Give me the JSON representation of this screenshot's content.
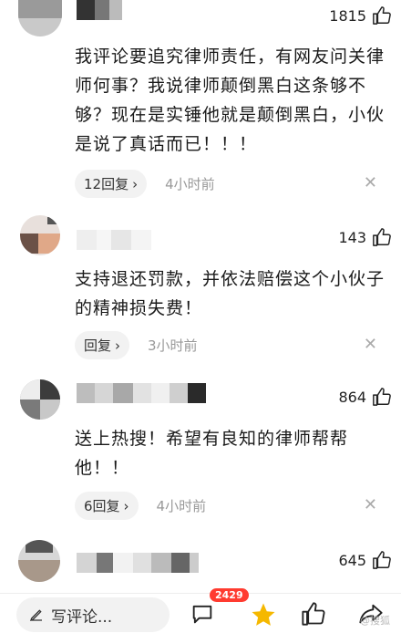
{
  "comments": [
    {
      "likes": "1815",
      "text": "我评论要追究律师责任，有网友问关律师何事？我说律师颠倒黑白这条够不够？现在是实锤他就是颠倒黑白，小伙是说了真话而已！！！",
      "reply_label": "12回复",
      "time": "4小时前"
    },
    {
      "likes": "143",
      "text": "支持退还罚款，并依法赔偿这个小伙子的精神损失费！",
      "reply_label": "回复",
      "time": "3小时前"
    },
    {
      "likes": "864",
      "text": "送上热搜！希望有良知的律师帮帮他！！",
      "reply_label": "6回复",
      "time": "4小时前"
    },
    {
      "likes": "645"
    }
  ],
  "bottom_bar": {
    "write_placeholder": "写评论...",
    "comment_count": "2429",
    "watermark": "@搜狐"
  },
  "colors": {
    "badge": "#ff3b30",
    "star": "#f5b800",
    "reply_bg": "#f2f2f2"
  },
  "icons": [
    "thumb-up-icon",
    "close-icon",
    "pencil-icon",
    "comment-bubble-icon",
    "star-icon",
    "share-icon"
  ]
}
